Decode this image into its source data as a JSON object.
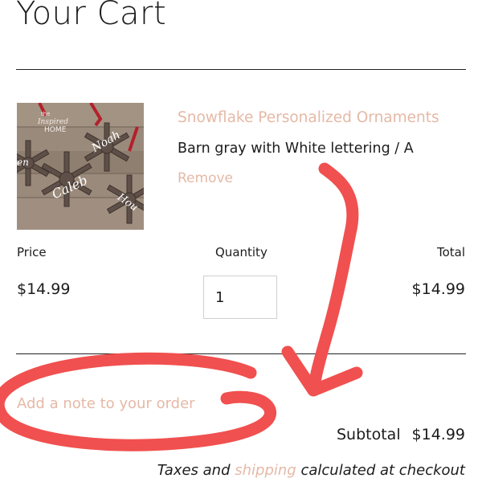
{
  "cart": {
    "title": "Your Cart"
  },
  "item": {
    "name": "Snowflake Personalized Ornaments",
    "variant": "Barn gray with White lettering / A",
    "remove_label": "Remove",
    "image": {
      "icon": "snowflake-ornaments-photo",
      "brand_text": "the Inspired HOME",
      "names": [
        "Noah",
        "Caleb",
        "Hou",
        "en"
      ]
    }
  },
  "columns": {
    "price_label": "Price",
    "quantity_label": "Quantity",
    "total_label": "Total"
  },
  "line": {
    "price": "$14.99",
    "quantity": "1",
    "total": "$14.99"
  },
  "footer": {
    "add_note_label": "Add a note to your order",
    "subtotal_label": "Subtotal",
    "subtotal_value": "$14.99",
    "taxes_prefix": "Taxes and ",
    "shipping_link": "shipping",
    "taxes_suffix": " calculated at checkout"
  },
  "colors": {
    "accent": "#e5b9a6",
    "text": "#1c1c1c",
    "annotation": "#f0504f"
  }
}
